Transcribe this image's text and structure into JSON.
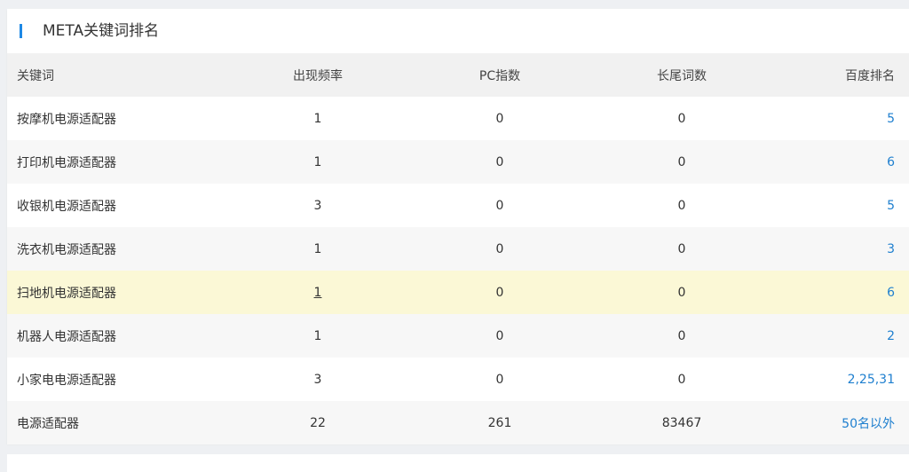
{
  "panel": {
    "title": "META关键词排名"
  },
  "table": {
    "headers": {
      "keyword": "关键词",
      "frequency": "出现频率",
      "pc_index": "PC指数",
      "long_tail": "长尾词数",
      "baidu_rank": "百度排名"
    },
    "rows": [
      {
        "keyword": "按摩机电源适配器",
        "frequency": "1",
        "pc_index": "0",
        "long_tail": "0",
        "baidu_rank": "5"
      },
      {
        "keyword": "打印机电源适配器",
        "frequency": "1",
        "pc_index": "0",
        "long_tail": "0",
        "baidu_rank": "6"
      },
      {
        "keyword": "收银机电源适配器",
        "frequency": "3",
        "pc_index": "0",
        "long_tail": "0",
        "baidu_rank": "5"
      },
      {
        "keyword": "洗衣机电源适配器",
        "frequency": "1",
        "pc_index": "0",
        "long_tail": "0",
        "baidu_rank": "3"
      },
      {
        "keyword": "扫地机电源适配器",
        "frequency": "1",
        "pc_index": "0",
        "long_tail": "0",
        "baidu_rank": "6"
      },
      {
        "keyword": "机器人电源适配器",
        "frequency": "1",
        "pc_index": "0",
        "long_tail": "0",
        "baidu_rank": "2"
      },
      {
        "keyword": "小家电电源适配器",
        "frequency": "3",
        "pc_index": "0",
        "long_tail": "0",
        "baidu_rank": "2,25,31"
      },
      {
        "keyword": "电源适配器",
        "frequency": "22",
        "pc_index": "261",
        "long_tail": "83467",
        "baidu_rank": "50名以外"
      }
    ]
  },
  "colors": {
    "accent": "#1e88e5",
    "link": "#1e7fcf",
    "header_bg": "#f1f1f1",
    "hover_row_bg": "#fbf8d6",
    "stripe_bg": "#f7f7f7",
    "page_bg": "#eef0f3"
  }
}
